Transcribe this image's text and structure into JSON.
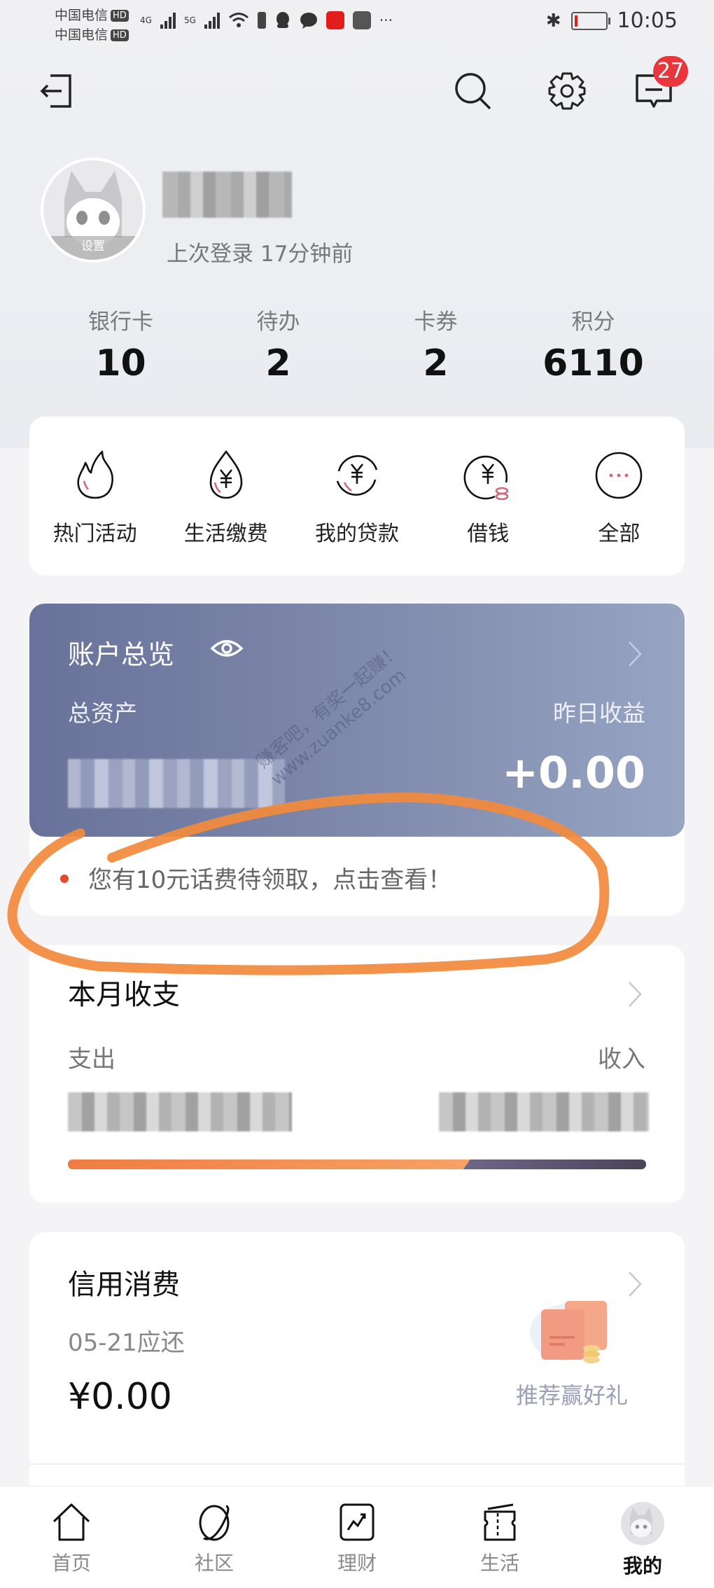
{
  "status_bar": {
    "carrier_1": "中国电信",
    "carrier_2": "中国电信",
    "hd_label": "HD",
    "net_1": "4G",
    "net_2": "5G",
    "more": "···",
    "time": "10:05",
    "icons": [
      "signal-icon",
      "wifi-icon",
      "battery-saver-icon",
      "qq-icon",
      "chat-icon",
      "app-icon",
      "huawei-icon",
      "bluetooth-icon",
      "battery-icon"
    ]
  },
  "header": {
    "logout_icon": "logout-icon",
    "search_icon": "search-icon",
    "settings_icon": "gear-icon",
    "messages_icon": "message-icon",
    "message_badge": "27"
  },
  "profile": {
    "avatar_label": "设置",
    "username": "",
    "last_login": "上次登录 17分钟前"
  },
  "stats": [
    {
      "label": "银行卡",
      "value": "10"
    },
    {
      "label": "待办",
      "value": "2"
    },
    {
      "label": "卡券",
      "value": "2"
    },
    {
      "label": "积分",
      "value": "6110"
    }
  ],
  "quick_actions": [
    {
      "label": "热门活动",
      "icon": "flame-icon"
    },
    {
      "label": "生活缴费",
      "icon": "yuan-drop-icon"
    },
    {
      "label": "我的贷款",
      "icon": "yuan-cycle-icon"
    },
    {
      "label": "借钱",
      "icon": "yuan-coin-icon"
    },
    {
      "label": "全部",
      "icon": "more-icon"
    }
  ],
  "account": {
    "title": "账户总览",
    "total_assets_label": "总资产",
    "total_assets_value": "",
    "yesterday_yield_label": "昨日收益",
    "yesterday_yield_value": "+0.00",
    "notice": "您有10元话费待领取，点击查看！"
  },
  "monthly": {
    "title": "本月收支",
    "expense_label": "支出",
    "income_label": "收入",
    "expense_share": 0.69,
    "colors": {
      "expense": "#f28a4f",
      "income": "#5b5470"
    }
  },
  "credit": {
    "title": "信用消费",
    "due_label": "05-21应还",
    "amount": "¥0.00",
    "promo_label": "推荐赢好礼"
  },
  "bottom_nav": [
    {
      "label": "首页",
      "icon": "home-icon",
      "active": false
    },
    {
      "label": "社区",
      "icon": "planet-icon",
      "active": false
    },
    {
      "label": "理财",
      "icon": "chart-icon",
      "active": false
    },
    {
      "label": "生活",
      "icon": "ticket-icon",
      "active": false
    },
    {
      "label": "我的",
      "icon": "avatar-icon",
      "active": true
    }
  ],
  "watermark": {
    "line1": "赚客吧，有奖一起赚！",
    "line2": "www.zuanke8.com"
  },
  "annotation_color": "#f28a3c"
}
